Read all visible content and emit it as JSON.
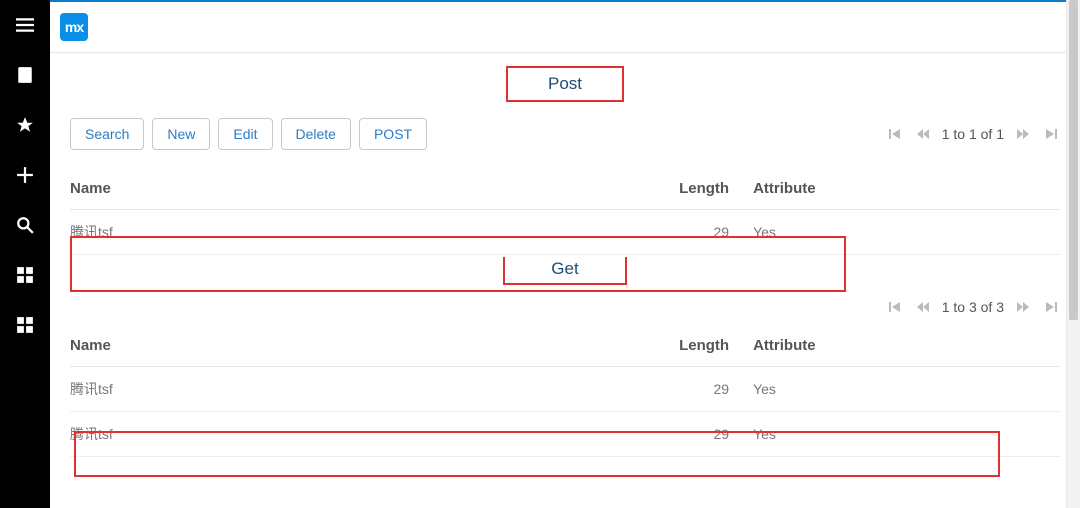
{
  "logo_text": "mx",
  "sections": {
    "post": {
      "title": "Post"
    },
    "get": {
      "title": "Get"
    }
  },
  "toolbar": {
    "search": "Search",
    "new": "New",
    "edit": "Edit",
    "delete": "Delete",
    "post": "POST"
  },
  "paginator1": {
    "info": "1 to 1 of 1"
  },
  "paginator2": {
    "info": "1 to 3 of 3"
  },
  "columns": {
    "name": "Name",
    "length": "Length",
    "attribute": "Attribute"
  },
  "table1": {
    "rows": [
      {
        "name": "腾讯tsf",
        "length": "29",
        "attribute": "Yes"
      }
    ]
  },
  "table2": {
    "rows": [
      {
        "name": "腾讯tsf",
        "length": "29",
        "attribute": "Yes"
      },
      {
        "name": "腾讯tsf",
        "length": "29",
        "attribute": "Yes"
      }
    ]
  }
}
